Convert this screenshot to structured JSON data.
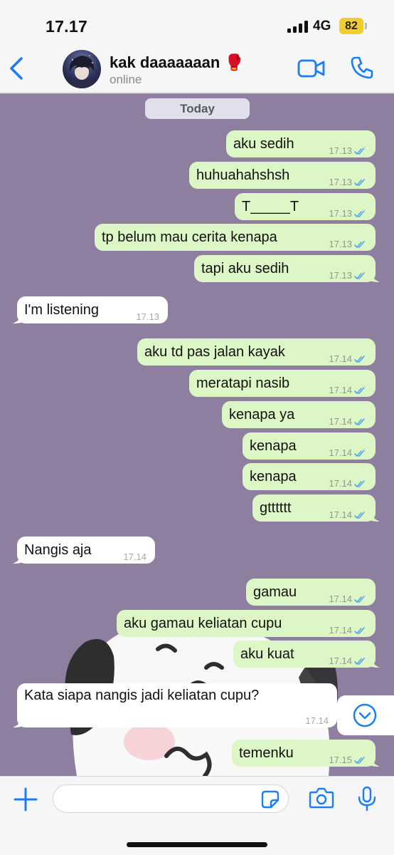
{
  "status_bar": {
    "time": "17.17",
    "network": "4G",
    "battery": "82"
  },
  "header": {
    "contact_name": "kak daaaaaaan 🥊",
    "contact_status": "online"
  },
  "chat": {
    "date_label": "Today",
    "messages": [
      {
        "dir": "out",
        "text": "aku sedih",
        "time": "17.13"
      },
      {
        "dir": "out",
        "text": "huhuahahshsh",
        "time": "17.13"
      },
      {
        "dir": "out",
        "text": "T_____T",
        "time": "17.13"
      },
      {
        "dir": "out",
        "text": "tp belum mau cerita kenapa",
        "time": "17.13"
      },
      {
        "dir": "out",
        "text": "tapi aku sedih",
        "time": "17.13"
      },
      {
        "dir": "in",
        "text": "I'm listening",
        "time": "17.13"
      },
      {
        "dir": "out",
        "text": "aku td pas jalan kayak",
        "time": "17.14"
      },
      {
        "dir": "out",
        "text": "meratapi nasib",
        "time": "17.14"
      },
      {
        "dir": "out",
        "text": "kenapa ya",
        "time": "17.14"
      },
      {
        "dir": "out",
        "text": "kenapa",
        "time": "17.14"
      },
      {
        "dir": "out",
        "text": "kenapa",
        "time": "17.14"
      },
      {
        "dir": "out",
        "text": "gtttttt",
        "time": "17.14"
      },
      {
        "dir": "in",
        "text": "Nangis aja",
        "time": "17.14"
      },
      {
        "dir": "out",
        "text": "gamau",
        "time": "17.14"
      },
      {
        "dir": "out",
        "text": "aku gamau keliatan cupu",
        "time": "17.14"
      },
      {
        "dir": "out",
        "text": "aku kuat",
        "time": "17.14"
      },
      {
        "dir": "in",
        "text": "Kata siapa nangis jadi keliatan cupu?",
        "time": "17.14"
      },
      {
        "dir": "out",
        "text": "temenku",
        "time": "17.15"
      }
    ]
  },
  "input": {
    "value": "",
    "placeholder": ""
  },
  "icons": {
    "back": "chevron-left-icon",
    "video": "video-camera-icon",
    "call": "phone-icon",
    "plus": "plus-icon",
    "sticker": "sticker-icon",
    "camera": "camera-icon",
    "mic": "microphone-icon",
    "scroll": "chevron-down-circle-icon",
    "read": "double-check-icon"
  },
  "colors": {
    "accent": "#1a7ef5",
    "outgoing_bubble": "#dcf7c5",
    "incoming_bubble": "#ffffff",
    "chat_background": "#8e7fa1",
    "read_ticks": "#53a6f0",
    "battery": "#f2cd2e"
  }
}
